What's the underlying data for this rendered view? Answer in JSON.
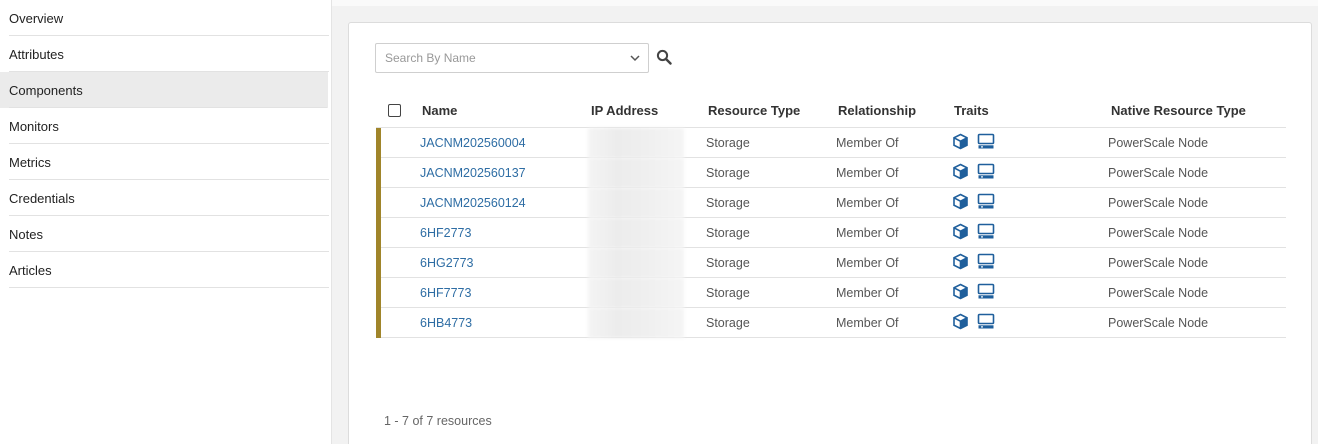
{
  "sidebar": {
    "items": [
      {
        "label": "Overview"
      },
      {
        "label": "Attributes"
      },
      {
        "label": "Components"
      },
      {
        "label": "Monitors"
      },
      {
        "label": "Metrics"
      },
      {
        "label": "Credentials"
      },
      {
        "label": "Notes"
      },
      {
        "label": "Articles"
      }
    ],
    "active": "Components"
  },
  "search": {
    "placeholder": "Search By Name",
    "value": ""
  },
  "table": {
    "columns": [
      "Name",
      "IP Address",
      "Resource Type",
      "Relationship",
      "Traits",
      "Native Resource Type"
    ],
    "rows": [
      {
        "name": "JACNM202560004",
        "resource_type": "Storage",
        "relationship": "Member Of",
        "traits": [
          "cube-icon",
          "server-icon"
        ],
        "native_type": "PowerScale Node"
      },
      {
        "name": "JACNM202560137",
        "resource_type": "Storage",
        "relationship": "Member Of",
        "traits": [
          "cube-icon",
          "server-icon"
        ],
        "native_type": "PowerScale Node"
      },
      {
        "name": "JACNM202560124",
        "resource_type": "Storage",
        "relationship": "Member Of",
        "traits": [
          "cube-icon",
          "server-icon"
        ],
        "native_type": "PowerScale Node"
      },
      {
        "name": "6HF2773",
        "resource_type": "Storage",
        "relationship": "Member Of",
        "traits": [
          "cube-icon",
          "server-icon"
        ],
        "native_type": "PowerScale Node"
      },
      {
        "name": "6HG2773",
        "resource_type": "Storage",
        "relationship": "Member Of",
        "traits": [
          "cube-icon",
          "server-icon"
        ],
        "native_type": "PowerScale Node"
      },
      {
        "name": "6HF7773",
        "resource_type": "Storage",
        "relationship": "Member Of",
        "traits": [
          "cube-icon",
          "server-icon"
        ],
        "native_type": "PowerScale Node"
      },
      {
        "name": "6HB4773",
        "resource_type": "Storage",
        "relationship": "Member Of",
        "traits": [
          "cube-icon",
          "server-icon"
        ],
        "native_type": "PowerScale Node"
      }
    ]
  },
  "footer": {
    "summary": "1 - 7 of 7 resources"
  },
  "colors": {
    "link": "#2e6da4",
    "status_bar": "#a0852a",
    "icon": "#1f5f9c"
  }
}
